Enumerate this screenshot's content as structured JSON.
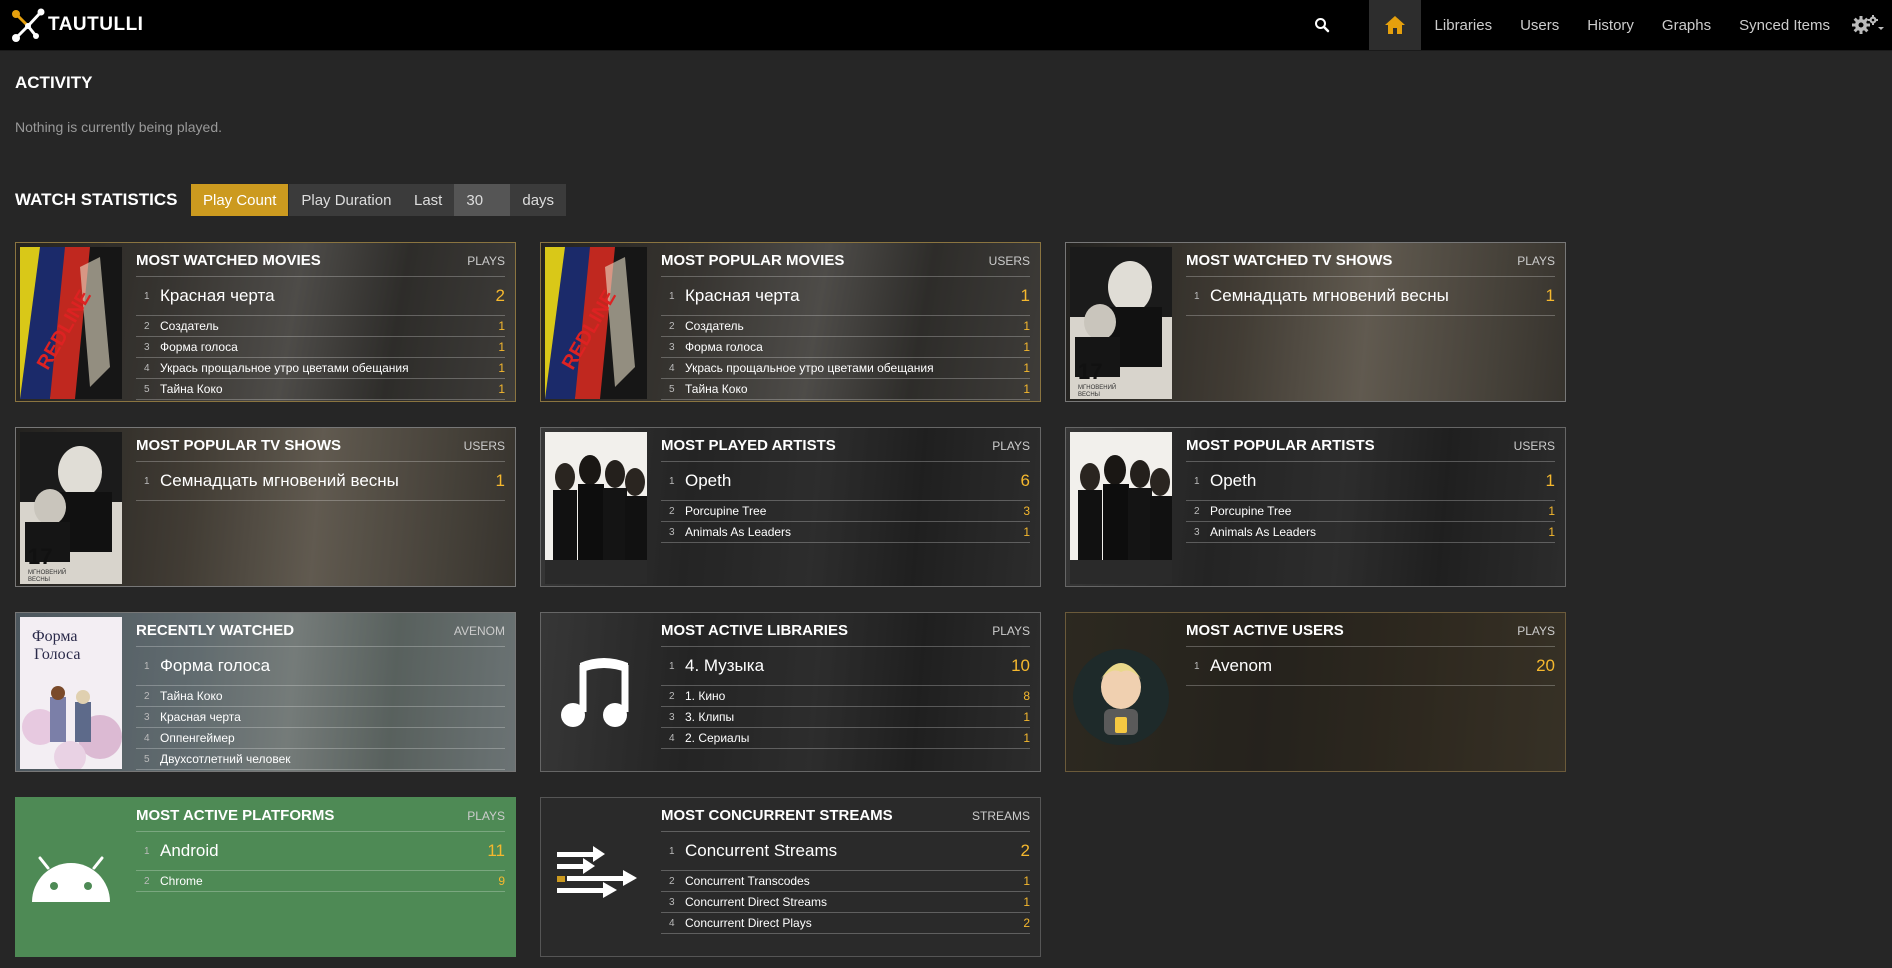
{
  "brand": {
    "name": "TAUTULLI"
  },
  "nav": {
    "links": [
      "Libraries",
      "Users",
      "History",
      "Graphs",
      "Synced Items"
    ]
  },
  "activity": {
    "title": "ACTIVITY",
    "empty_text": "Nothing is currently being played."
  },
  "watch_stats": {
    "title": "WATCH STATISTICS",
    "toggle": [
      "Play Count",
      "Play Duration"
    ],
    "last_label": "Last",
    "days_value": "30",
    "days_label": "days"
  },
  "cards": [
    {
      "title": "MOST WATCHED MOVIES",
      "unit": "PLAYS",
      "top": {
        "rank": "1",
        "name": "Красная черта",
        "count": "2"
      },
      "rows": [
        {
          "rank": "2",
          "name": "Создатель",
          "count": "1"
        },
        {
          "rank": "3",
          "name": "Форма голоса",
          "count": "1"
        },
        {
          "rank": "4",
          "name": "Укрась прощальное утро цветами обещания",
          "count": "1"
        },
        {
          "rank": "5",
          "name": "Тайна Коко",
          "count": "1"
        }
      ]
    },
    {
      "title": "MOST POPULAR MOVIES",
      "unit": "USERS",
      "top": {
        "rank": "1",
        "name": "Красная черта",
        "count": "1"
      },
      "rows": [
        {
          "rank": "2",
          "name": "Создатель",
          "count": "1"
        },
        {
          "rank": "3",
          "name": "Форма голоса",
          "count": "1"
        },
        {
          "rank": "4",
          "name": "Укрась прощальное утро цветами обещания",
          "count": "1"
        },
        {
          "rank": "5",
          "name": "Тайна Коко",
          "count": "1"
        }
      ]
    },
    {
      "title": "MOST WATCHED TV SHOWS",
      "unit": "PLAYS",
      "top": {
        "rank": "1",
        "name": "Семнадцать мгновений весны",
        "count": "1"
      },
      "rows": []
    },
    {
      "title": "MOST POPULAR TV SHOWS",
      "unit": "USERS",
      "top": {
        "rank": "1",
        "name": "Семнадцать мгновений весны",
        "count": "1"
      },
      "rows": []
    },
    {
      "title": "MOST PLAYED ARTISTS",
      "unit": "PLAYS",
      "top": {
        "rank": "1",
        "name": "Opeth",
        "count": "6"
      },
      "rows": [
        {
          "rank": "2",
          "name": "Porcupine Tree",
          "count": "3"
        },
        {
          "rank": "3",
          "name": "Animals As Leaders",
          "count": "1"
        }
      ]
    },
    {
      "title": "MOST POPULAR ARTISTS",
      "unit": "USERS",
      "top": {
        "rank": "1",
        "name": "Opeth",
        "count": "1"
      },
      "rows": [
        {
          "rank": "2",
          "name": "Porcupine Tree",
          "count": "1"
        },
        {
          "rank": "3",
          "name": "Animals As Leaders",
          "count": "1"
        }
      ]
    },
    {
      "title": "RECENTLY WATCHED",
      "unit": "AVENOM",
      "top": {
        "rank": "1",
        "name": "Форма голоса",
        "count": ""
      },
      "rows": [
        {
          "rank": "2",
          "name": "Тайна Коко",
          "count": ""
        },
        {
          "rank": "3",
          "name": "Красная черта",
          "count": ""
        },
        {
          "rank": "4",
          "name": "Оппенгеймер",
          "count": ""
        },
        {
          "rank": "5",
          "name": "Двухсотлетний человек",
          "count": ""
        }
      ]
    },
    {
      "title": "MOST ACTIVE LIBRARIES",
      "unit": "PLAYS",
      "top": {
        "rank": "1",
        "name": "4. Музыка",
        "count": "10"
      },
      "rows": [
        {
          "rank": "2",
          "name": "1. Кино",
          "count": "8"
        },
        {
          "rank": "3",
          "name": "3. Клипы",
          "count": "1"
        },
        {
          "rank": "4",
          "name": "2. Сериалы",
          "count": "1"
        }
      ]
    },
    {
      "title": "MOST ACTIVE USERS",
      "unit": "PLAYS",
      "top": {
        "rank": "1",
        "name": "Avenom",
        "count": "20"
      },
      "rows": []
    },
    {
      "title": "MOST ACTIVE PLATFORMS",
      "unit": "PLAYS",
      "top": {
        "rank": "1",
        "name": "Android",
        "count": "11"
      },
      "rows": [
        {
          "rank": "2",
          "name": "Chrome",
          "count": "9"
        }
      ]
    },
    {
      "title": "MOST CONCURRENT STREAMS",
      "unit": "STREAMS",
      "top": {
        "rank": "1",
        "name": "Concurrent Streams",
        "count": "2"
      },
      "rows": [
        {
          "rank": "2",
          "name": "Concurrent Transcodes",
          "count": "1"
        },
        {
          "rank": "3",
          "name": "Concurrent Direct Streams",
          "count": "1"
        },
        {
          "rank": "4",
          "name": "Concurrent Direct Plays",
          "count": "2"
        }
      ]
    }
  ],
  "colors": {
    "accent": "#cc9a1f",
    "count": "#f5b82e",
    "platform_green": "#4e8a55",
    "background": "#262626"
  },
  "icons": [
    "search-icon",
    "home-icon",
    "gear-icon",
    "music-note-icon",
    "android-icon",
    "streams-icon"
  ]
}
